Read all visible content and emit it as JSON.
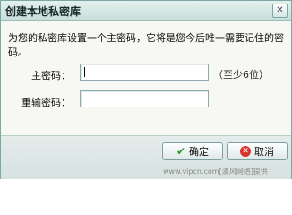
{
  "window": {
    "title": "创建本地私密库",
    "close_icon": "close-icon"
  },
  "message": "为您的私密库设置一个主密码，它将是您今后唯一需要记住的密码。",
  "form": {
    "password_label": "主密码：",
    "password_hint": "（至少6位）",
    "confirm_label": "重输密码："
  },
  "buttons": {
    "ok_label": "确定",
    "ok_icon": "checkmark-icon",
    "cancel_label": "取消",
    "cancel_icon": "cancel-icon"
  },
  "watermark": "www.vipcn.com[清风网络]提供",
  "colors": {
    "title_bar": "#c7dfdc",
    "border": "#7aa7a8",
    "ok_icon": "#2a9a2a",
    "cancel_icon": "#d9342b"
  }
}
